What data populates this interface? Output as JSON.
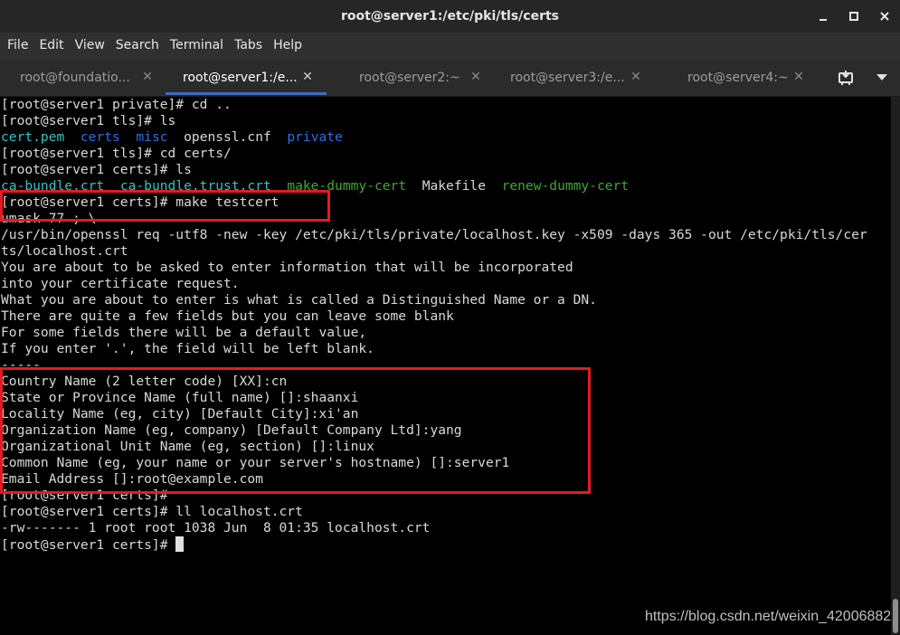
{
  "window": {
    "title": "root@server1:/etc/pki/tls/certs"
  },
  "menu": [
    "File",
    "Edit",
    "View",
    "Search",
    "Terminal",
    "Tabs",
    "Help"
  ],
  "tabs": [
    {
      "label": "root@foundatio..."
    },
    {
      "label": "root@server1:/e...",
      "active": true
    },
    {
      "label": "root@server2:~"
    },
    {
      "label": "root@server3:/e..."
    },
    {
      "label": "root@server4:~"
    }
  ],
  "terminal": {
    "lines": [
      "[root@server1 private]# cd ..",
      "[root@server1 tls]# ls",
      {
        "segments": [
          {
            "text": "cert.pem",
            "color": "cyan"
          },
          {
            "text": "  "
          },
          {
            "text": "certs",
            "color": "blue"
          },
          {
            "text": "  "
          },
          {
            "text": "misc",
            "color": "blue"
          },
          {
            "text": "  openssl.cnf  "
          },
          {
            "text": "private",
            "color": "blue"
          }
        ]
      },
      "[root@server1 tls]# cd certs/",
      "[root@server1 certs]# ls",
      {
        "segments": [
          {
            "text": "ca-bundle.crt",
            "color": "cyan"
          },
          {
            "text": "  "
          },
          {
            "text": "ca-bundle.trust.crt",
            "color": "cyan"
          },
          {
            "text": "  "
          },
          {
            "text": "make-dummy-cert",
            "color": "green"
          },
          {
            "text": "  Makefile  "
          },
          {
            "text": "renew-dummy-cert",
            "color": "green"
          }
        ]
      },
      "[root@server1 certs]# make testcert",
      "umask 77 ; \\",
      "/usr/bin/openssl req -utf8 -new -key /etc/pki/tls/private/localhost.key -x509 -days 365 -out /etc/pki/tls/cer",
      "ts/localhost.crt",
      "You are about to be asked to enter information that will be incorporated",
      "into your certificate request.",
      "What you are about to enter is what is called a Distinguished Name or a DN.",
      "There are quite a few fields but you can leave some blank",
      "For some fields there will be a default value,",
      "If you enter '.', the field will be left blank.",
      "-----",
      "Country Name (2 letter code) [XX]:cn",
      "State or Province Name (full name) []:shaanxi",
      "Locality Name (eg, city) [Default City]:xi'an",
      "Organization Name (eg, company) [Default Company Ltd]:yang",
      "Organizational Unit Name (eg, section) []:linux",
      "Common Name (eg, your name or your server's hostname) []:server1",
      "Email Address []:root@example.com",
      "[root@server1 certs]#",
      "[root@server1 certs]# ll localhost.crt",
      "-rw------- 1 root root 1038 Jun  8 01:35 localhost.crt",
      "[root@server1 certs]# "
    ],
    "colors": {
      "cyan": "#34c4c4",
      "blue": "#2f6fe0",
      "green": "#3eaa2e",
      "highlight": "#e21b23"
    }
  },
  "watermark": "https://blog.csdn.net/weixin_42006882"
}
